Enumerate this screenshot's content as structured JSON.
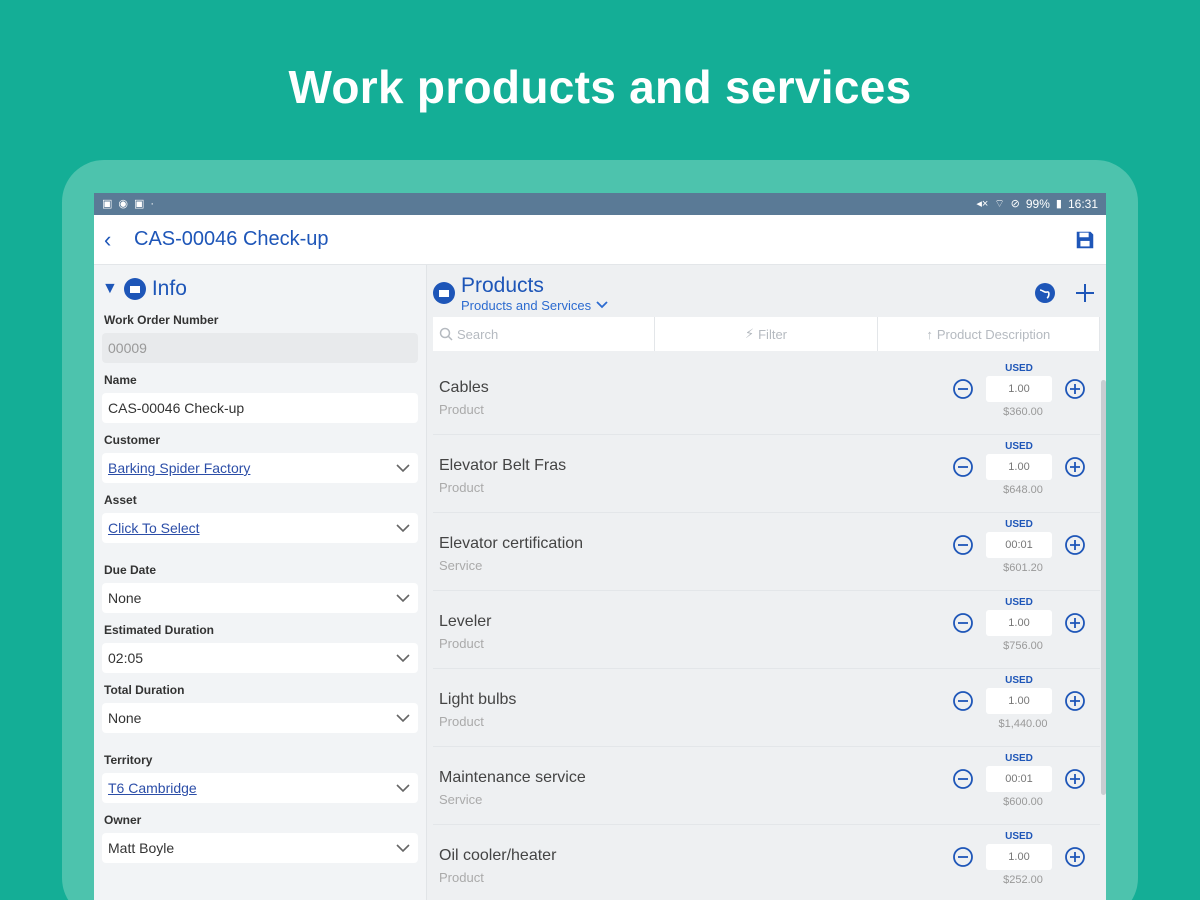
{
  "headline": "Work products and services",
  "status": {
    "battery": "99%",
    "time": "16:31"
  },
  "appbar": {
    "title": "CAS-00046 Check-up"
  },
  "info": {
    "title": "Info",
    "fields": [
      {
        "label": "Work Order Number",
        "value": "00009",
        "style": "disabled"
      },
      {
        "label": "Name",
        "value": "CAS-00046 Check-up",
        "style": "text"
      },
      {
        "label": "Customer",
        "value": "Barking Spider Factory",
        "style": "link"
      },
      {
        "label": "Asset",
        "value": "Click To Select",
        "style": "link"
      },
      {
        "label": "Due Date",
        "value": "None",
        "style": "select"
      },
      {
        "label": "Estimated Duration",
        "value": "02:05",
        "style": "select"
      },
      {
        "label": "Total Duration",
        "value": "None",
        "style": "select"
      },
      {
        "label": "Territory",
        "value": "T6 Cambridge",
        "style": "link"
      },
      {
        "label": "Owner",
        "value": "Matt Boyle",
        "style": "select"
      }
    ]
  },
  "products": {
    "title": "Products",
    "subtitle": "Products and Services",
    "search_placeholder": "Search",
    "filter_label": "Filter",
    "sort_label": "Product Description",
    "used_label": "USED",
    "items": [
      {
        "name": "Cables",
        "type": "Product",
        "qty": "1.00",
        "price": "$360.00"
      },
      {
        "name": "Elevator Belt Fras",
        "type": "Product",
        "qty": "1.00",
        "price": "$648.00"
      },
      {
        "name": "Elevator certification",
        "type": "Service",
        "qty": "00:01",
        "price": "$601.20"
      },
      {
        "name": "Leveler",
        "type": "Product",
        "qty": "1.00",
        "price": "$756.00"
      },
      {
        "name": "Light bulbs",
        "type": "Product",
        "qty": "1.00",
        "price": "$1,440.00"
      },
      {
        "name": "Maintenance service",
        "type": "Service",
        "qty": "00:01",
        "price": "$600.00"
      },
      {
        "name": "Oil cooler/heater",
        "type": "Product",
        "qty": "1.00",
        "price": "$252.00"
      }
    ]
  },
  "colors": {
    "brand": "#14ae96",
    "accent": "#1e56b8",
    "statusbar": "#5a7a96"
  }
}
